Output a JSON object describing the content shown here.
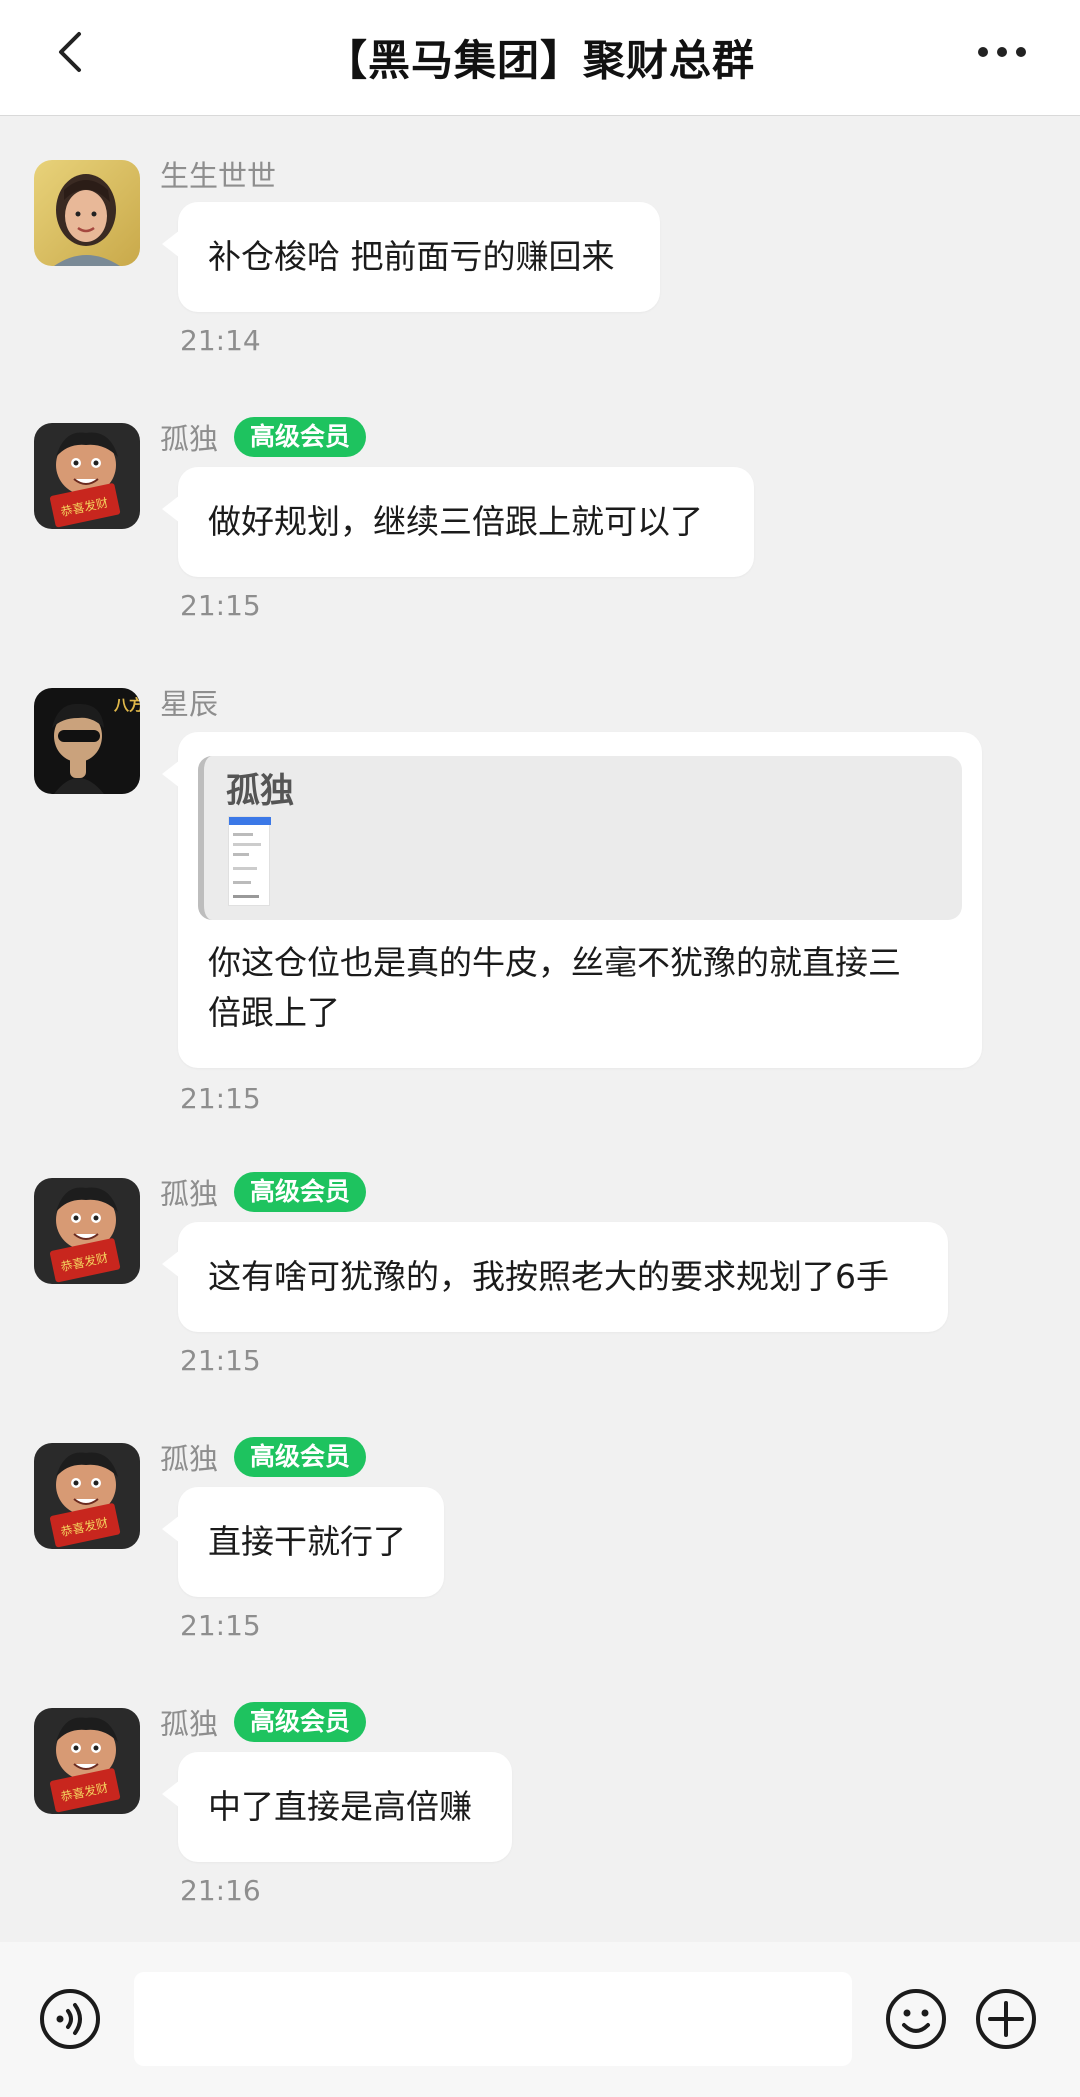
{
  "header": {
    "title": "【黑马集团】聚财总群"
  },
  "messages": [
    {
      "name": "生生世世",
      "badge": "",
      "text": "补仓梭哈 把前面亏的赚回来",
      "time": "21:14"
    },
    {
      "name": "孤独",
      "badge": "高级会员",
      "text": "做好规划，继续三倍跟上就可以了",
      "time": "21:15"
    },
    {
      "name": "星辰",
      "badge": "",
      "quote_name": "孤独",
      "text_line1": "你这仓位也是真的牛皮，丝毫不犹豫的就直接三",
      "text_line2": "倍跟上了",
      "time": "21:15"
    },
    {
      "name": "孤独",
      "badge": "高级会员",
      "text": "这有啥可犹豫的，我按照老大的要求规划了6手",
      "time": "21:15"
    },
    {
      "name": "孤独",
      "badge": "高级会员",
      "text": "直接干就行了",
      "time": "21:15"
    },
    {
      "name": "孤独",
      "badge": "高级会员",
      "text": "中了直接是高倍赚",
      "time": "21:16"
    }
  ],
  "avatars": {
    "xingchen_logo_text": "八方来财",
    "gudu_sign_text": "恭喜发财"
  },
  "colors": {
    "badge_green": "#1ec35f",
    "background": "#f1f1f1",
    "bubble": "#ffffff"
  },
  "icons": {
    "back": "chevron-left-icon",
    "more": "more-dots-icon",
    "voice": "voice-icon",
    "emoji": "emoji-icon",
    "plus": "plus-icon"
  }
}
